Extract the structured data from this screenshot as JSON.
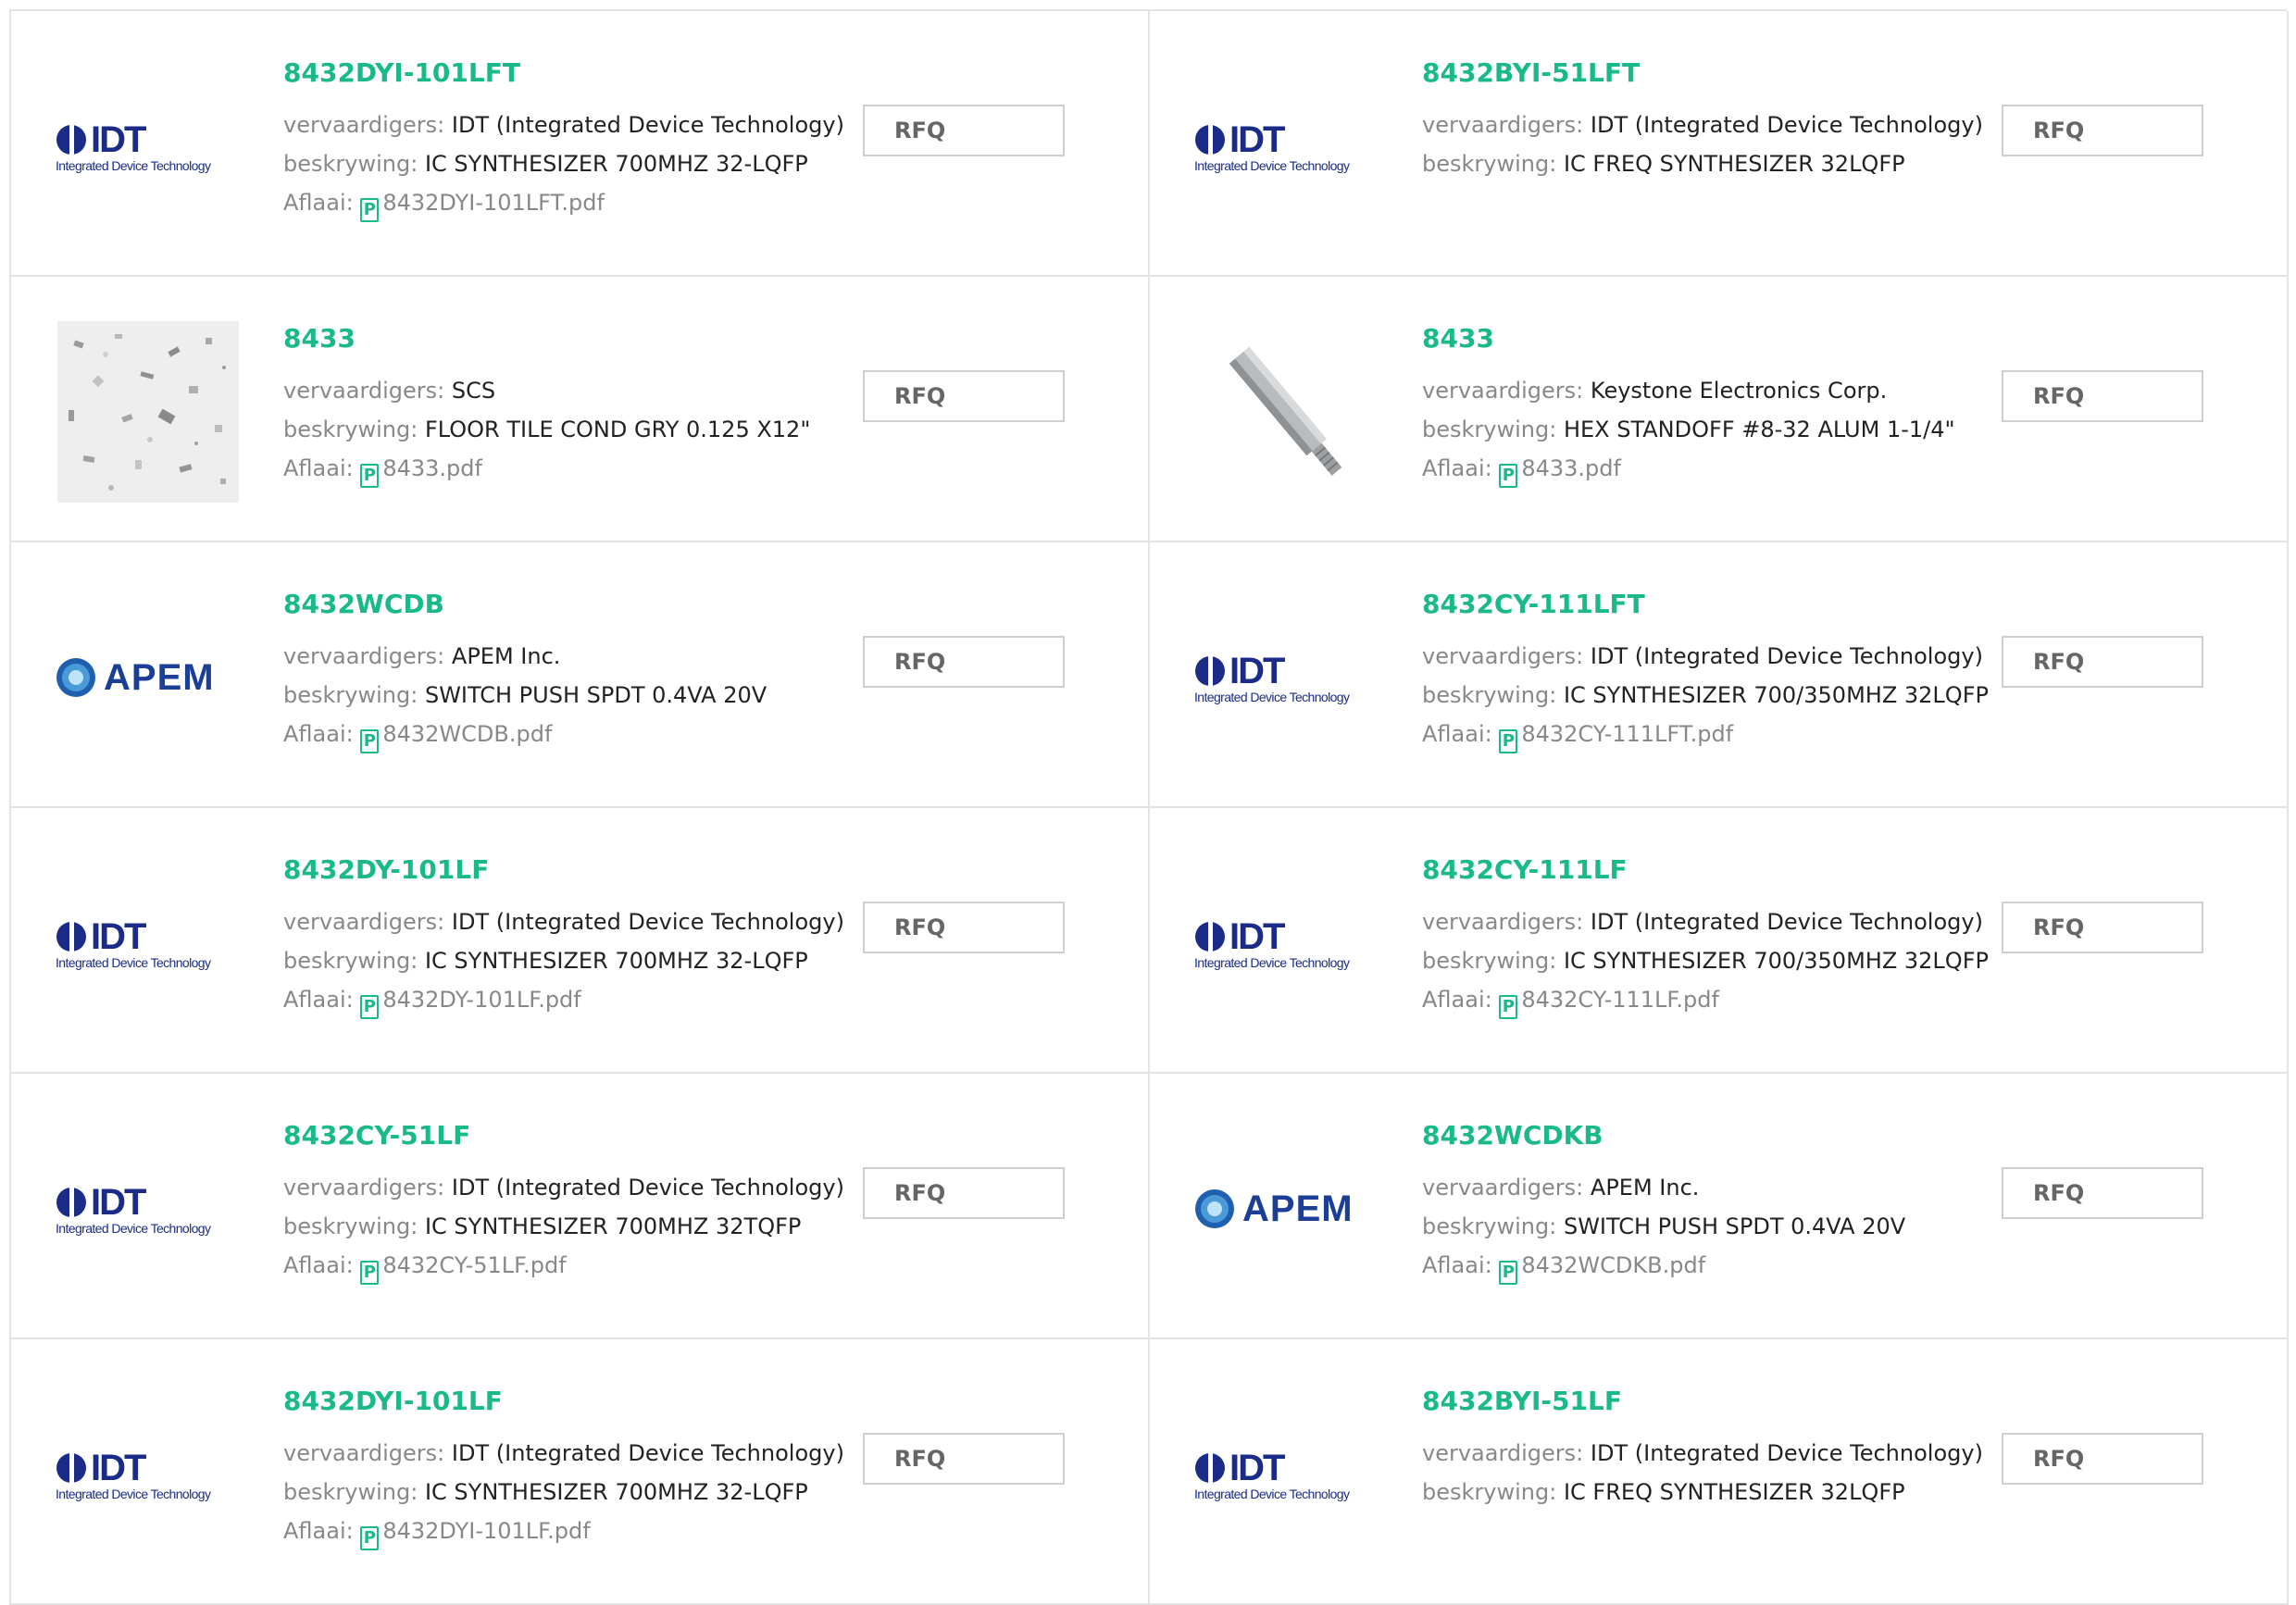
{
  "labels": {
    "manufacturer": "vervaardigers:",
    "description": "beskrywing:",
    "download": "Aflaai:",
    "rfq": "RFQ"
  },
  "logos": {
    "idt_short": "IDT",
    "idt_sub": "Integrated Device Technology",
    "apem": "APEM"
  },
  "colors": {
    "link_green": "#1ab98a",
    "idt_blue": "#1a2c88",
    "apem_blue": "#1b3f96"
  },
  "icons": {
    "pdf": "pdf-icon"
  },
  "products": [
    {
      "pn": "8432DYI-101LFT",
      "mfr": "IDT (Integrated Device Technology)",
      "desc": "IC SYNTHESIZER 700MHZ 32-LQFP",
      "pdf": "8432DYI-101LFT.pdf"
    },
    {
      "pn": "8432BYI-51LFT",
      "mfr": "IDT (Integrated Device Technology)",
      "desc": "IC FREQ SYNTHESIZER 32LQFP",
      "pdf": ""
    },
    {
      "pn": "8433",
      "mfr": "SCS",
      "desc": "FLOOR TILE COND GRY 0.125 X12\"",
      "pdf": "8433.pdf"
    },
    {
      "pn": "8433",
      "mfr": "Keystone Electronics Corp.",
      "desc": "HEX STANDOFF #8-32 ALUM 1-1/4\"",
      "pdf": "8433.pdf"
    },
    {
      "pn": "8432WCDB",
      "mfr": "APEM Inc.",
      "desc": "SWITCH PUSH SPDT 0.4VA 20V",
      "pdf": "8432WCDB.pdf"
    },
    {
      "pn": "8432CY-111LFT",
      "mfr": "IDT (Integrated Device Technology)",
      "desc": "IC SYNTHESIZER 700/350MHZ 32LQFP",
      "pdf": "8432CY-111LFT.pdf"
    },
    {
      "pn": "8432DY-101LF",
      "mfr": "IDT (Integrated Device Technology)",
      "desc": "IC SYNTHESIZER 700MHZ 32-LQFP",
      "pdf": "8432DY-101LF.pdf"
    },
    {
      "pn": "8432CY-111LF",
      "mfr": "IDT (Integrated Device Technology)",
      "desc": "IC SYNTHESIZER 700/350MHZ 32LQFP",
      "pdf": "8432CY-111LF.pdf"
    },
    {
      "pn": "8432CY-51LF",
      "mfr": "IDT (Integrated Device Technology)",
      "desc": "IC SYNTHESIZER 700MHZ 32TQFP",
      "pdf": "8432CY-51LF.pdf"
    },
    {
      "pn": "8432WCDKB",
      "mfr": "APEM Inc.",
      "desc": "SWITCH PUSH SPDT 0.4VA 20V",
      "pdf": "8432WCDKB.pdf"
    },
    {
      "pn": "8432DYI-101LF",
      "mfr": "IDT (Integrated Device Technology)",
      "desc": "IC SYNTHESIZER 700MHZ 32-LQFP",
      "pdf": "8432DYI-101LF.pdf"
    },
    {
      "pn": "8432BYI-51LF",
      "mfr": "IDT (Integrated Device Technology)",
      "desc": "IC FREQ SYNTHESIZER 32LQFP",
      "pdf": ""
    }
  ]
}
